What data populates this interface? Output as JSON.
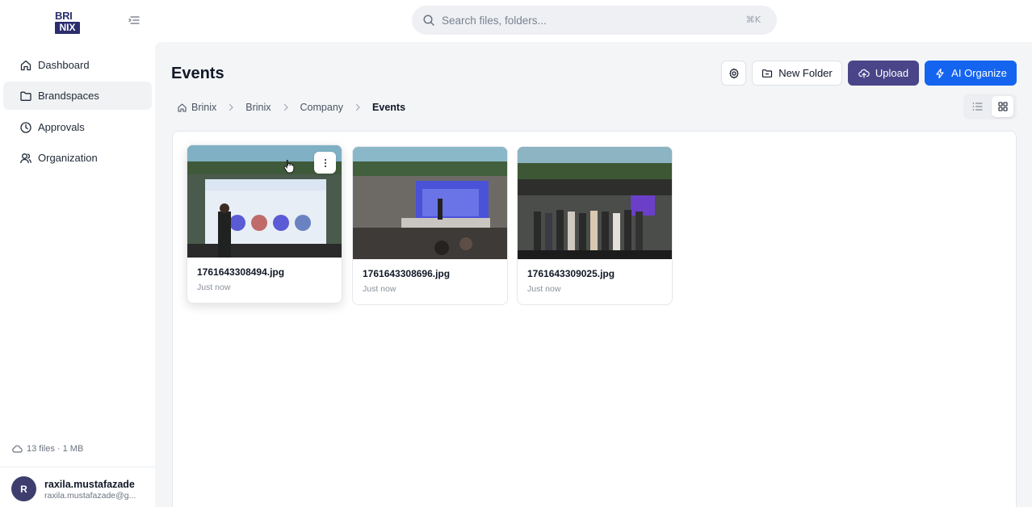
{
  "app": {
    "logo_top": "BRI",
    "logo_bottom": "NIX"
  },
  "search": {
    "placeholder": "Search files, folders...",
    "shortcut": "⌘K"
  },
  "sidebar": {
    "items": [
      {
        "label": "Dashboard",
        "icon": "home-icon",
        "active": false
      },
      {
        "label": "Brandspaces",
        "icon": "folder-icon",
        "active": true
      },
      {
        "label": "Approvals",
        "icon": "clock-icon",
        "active": false
      },
      {
        "label": "Organization",
        "icon": "users-icon",
        "active": false
      }
    ],
    "storage": "13 files · 1 MB",
    "user": {
      "initial": "R",
      "name": "raxila.mustafazade",
      "email": "raxila.mustafazade@g..."
    }
  },
  "main": {
    "title": "Events",
    "actions": {
      "new_folder": "New Folder",
      "upload": "Upload",
      "ai_organize": "AI Organize"
    },
    "breadcrumb": [
      "Brinix",
      "Brinix",
      "Company",
      "Events"
    ],
    "files": [
      {
        "name": "1761643308494.jpg",
        "time": "Just now"
      },
      {
        "name": "1761643308696.jpg",
        "time": "Just now"
      },
      {
        "name": "1761643309025.jpg",
        "time": "Just now"
      }
    ]
  },
  "colors": {
    "upload_bg": "#4a4589",
    "ai_bg": "#1464f0",
    "brand": "#2b2d6e"
  }
}
